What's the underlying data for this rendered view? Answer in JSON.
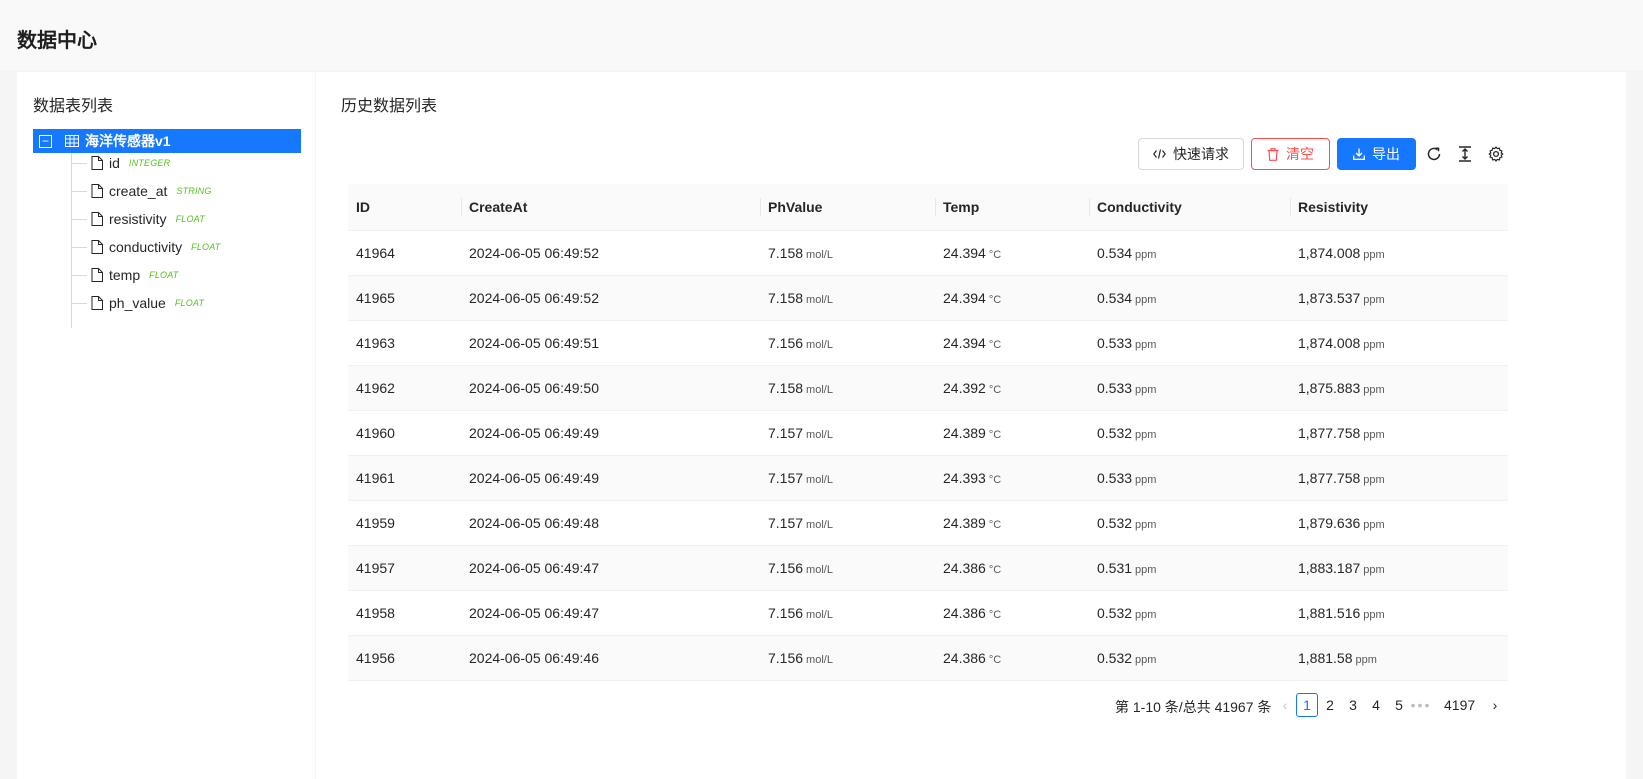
{
  "header": {
    "title": "数据中心"
  },
  "left": {
    "title": "数据表列表",
    "root": {
      "label": "海洋传感器v1",
      "expanded_symbol": "−"
    },
    "fields": [
      {
        "name": "id",
        "type": "INTEGER"
      },
      {
        "name": "create_at",
        "type": "STRING"
      },
      {
        "name": "resistivity",
        "type": "FLOAT"
      },
      {
        "name": "conductivity",
        "type": "FLOAT"
      },
      {
        "name": "temp",
        "type": "FLOAT"
      },
      {
        "name": "ph_value",
        "type": "FLOAT"
      }
    ]
  },
  "right": {
    "title": "历史数据列表",
    "toolbar": {
      "quick_label": "快速请求",
      "clear_label": "清空",
      "export_label": "导出",
      "icons": [
        "reload-icon",
        "column-height-icon",
        "setting-icon"
      ]
    },
    "table": {
      "columns": [
        "ID",
        "CreateAt",
        "PhValue",
        "Temp",
        "Conductivity",
        "Resistivity"
      ],
      "units": {
        "ph": "mol/L",
        "temp": "°C",
        "cond": "ppm",
        "res": "ppm"
      },
      "rows": [
        {
          "id": "41964",
          "created": "2024-06-05 06:49:52",
          "ph": "7.158",
          "temp": "24.394",
          "cond": "0.534",
          "res": "1,874.008"
        },
        {
          "id": "41965",
          "created": "2024-06-05 06:49:52",
          "ph": "7.158",
          "temp": "24.394",
          "cond": "0.534",
          "res": "1,873.537"
        },
        {
          "id": "41963",
          "created": "2024-06-05 06:49:51",
          "ph": "7.156",
          "temp": "24.394",
          "cond": "0.533",
          "res": "1,874.008"
        },
        {
          "id": "41962",
          "created": "2024-06-05 06:49:50",
          "ph": "7.158",
          "temp": "24.392",
          "cond": "0.533",
          "res": "1,875.883"
        },
        {
          "id": "41960",
          "created": "2024-06-05 06:49:49",
          "ph": "7.157",
          "temp": "24.389",
          "cond": "0.532",
          "res": "1,877.758"
        },
        {
          "id": "41961",
          "created": "2024-06-05 06:49:49",
          "ph": "7.157",
          "temp": "24.393",
          "cond": "0.533",
          "res": "1,877.758"
        },
        {
          "id": "41959",
          "created": "2024-06-05 06:49:48",
          "ph": "7.157",
          "temp": "24.389",
          "cond": "0.532",
          "res": "1,879.636"
        },
        {
          "id": "41957",
          "created": "2024-06-05 06:49:47",
          "ph": "7.156",
          "temp": "24.386",
          "cond": "0.531",
          "res": "1,883.187"
        },
        {
          "id": "41958",
          "created": "2024-06-05 06:49:47",
          "ph": "7.156",
          "temp": "24.386",
          "cond": "0.532",
          "res": "1,881.516"
        },
        {
          "id": "41956",
          "created": "2024-06-05 06:49:46",
          "ph": "7.156",
          "temp": "24.386",
          "cond": "0.532",
          "res": "1,881.58"
        }
      ]
    },
    "pagination": {
      "total_text": "第 1-10 条/总共 41967 条",
      "prev": "‹",
      "pages": [
        "1",
        "2",
        "3",
        "4",
        "5"
      ],
      "current": "1",
      "ellipsis": "•••",
      "last": "4197",
      "next": "›"
    }
  },
  "colors": {
    "primary": "#1677ff",
    "danger": "#ff4d4f",
    "type_tag": "#52c41a"
  }
}
